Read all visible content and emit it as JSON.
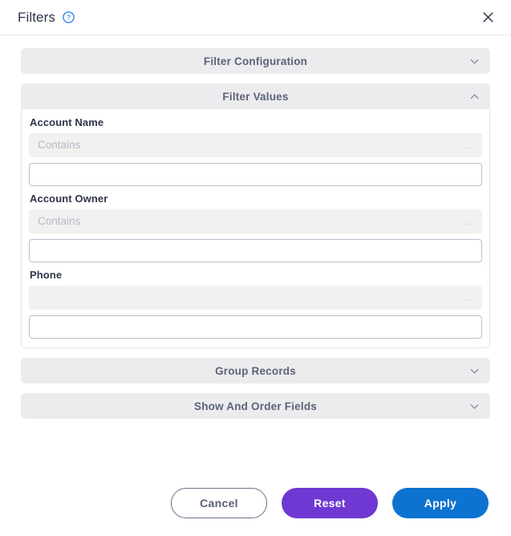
{
  "header": {
    "title": "Filters",
    "help_icon": "help-circle-icon",
    "close_icon": "close-icon"
  },
  "sections": [
    {
      "id": "filter-configuration",
      "label": "Filter Configuration",
      "expanded": false,
      "chevron": "chevron-down-icon"
    },
    {
      "id": "filter-values",
      "label": "Filter Values",
      "expanded": true,
      "chevron": "chevron-up-icon"
    },
    {
      "id": "group-records",
      "label": "Group Records",
      "expanded": false,
      "chevron": "chevron-down-icon"
    },
    {
      "id": "show-and-order-fields",
      "label": "Show And Order Fields",
      "expanded": false,
      "chevron": "chevron-down-icon"
    }
  ],
  "filter_values": {
    "fields": [
      {
        "label": "Account Name",
        "operator": "Contains",
        "operator_ellipsis": "...",
        "value": "",
        "value_placeholder": ""
      },
      {
        "label": "Account Owner",
        "operator": "Contains",
        "operator_ellipsis": "...",
        "value": "",
        "value_placeholder": ""
      },
      {
        "label": "Phone",
        "operator": "",
        "operator_ellipsis": "...",
        "value": "",
        "value_placeholder": ""
      }
    ]
  },
  "footer": {
    "cancel_label": "Cancel",
    "reset_label": "Reset",
    "apply_label": "Apply"
  },
  "colors": {
    "reset_bg": "#6f38d2",
    "apply_bg": "#0d73d1",
    "help_icon": "#1a73e8",
    "accordion_bg": "#ececee",
    "accordion_text": "#5b6378"
  }
}
